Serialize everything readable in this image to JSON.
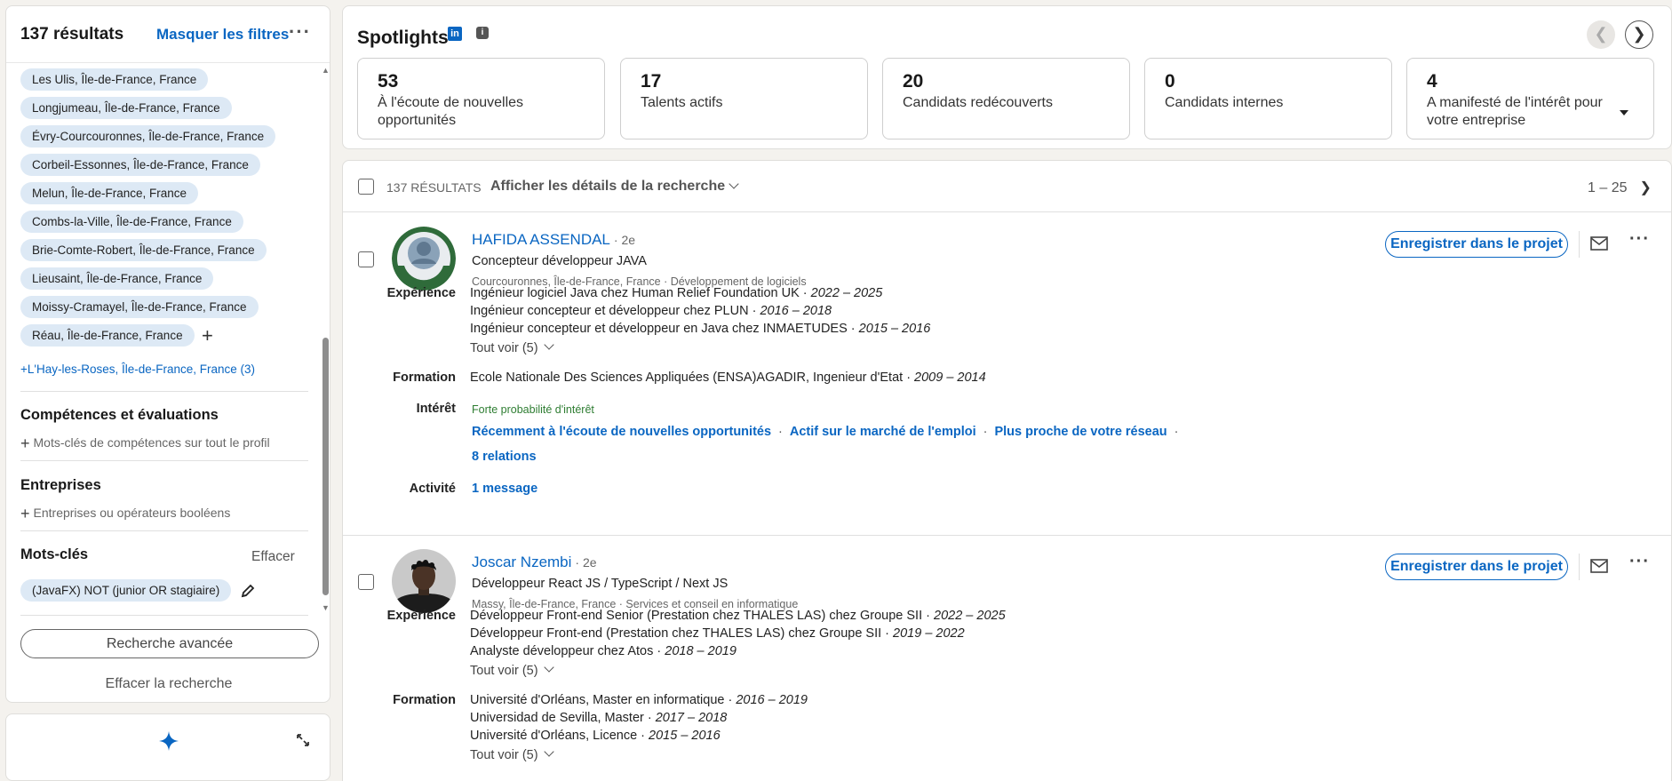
{
  "filters": {
    "result_count": "137 résultats",
    "hide_filters": "Masquer les filtres",
    "locations": [
      "Les Ulis, Île-de-France, France",
      "Longjumeau, Île-de-France, France",
      "Évry-Courcouronnes, Île-de-France, France",
      "Corbeil-Essonnes, Île-de-France, France",
      "Melun, Île-de-France, France",
      "Combs-la-Ville, Île-de-France, France",
      "Brie-Comte-Robert, Île-de-France, France",
      "Lieusaint, Île-de-France, France",
      "Moissy-Cramayel, Île-de-France, France",
      "Réau, Île-de-France, France"
    ],
    "more_locations": "+L'Hay-les-Roses, Île-de-France, France (3)",
    "skills_title": "Compétences et évaluations",
    "skills_add": "Mots-clés de compétences sur tout le profil",
    "companies_title": "Entreprises",
    "companies_add": "Entreprises ou opérateurs booléens",
    "keywords_title": "Mots-clés",
    "keywords_clear": "Effacer",
    "keyword_value": "(JavaFX) NOT (junior OR stagiaire)",
    "advanced_search": "Recherche avancée",
    "clear_search": "Effacer la recherche"
  },
  "spotlights": {
    "title": "Spotlights",
    "li_logo": "in",
    "info_icon": "i",
    "prev": "❮",
    "next": "❯",
    "cards": [
      {
        "num": "53",
        "label": "À l'écoute de nouvelles opportunités"
      },
      {
        "num": "17",
        "label": "Talents actifs"
      },
      {
        "num": "20",
        "label": "Candidats redécouverts"
      },
      {
        "num": "0",
        "label": "Candidats internes"
      },
      {
        "num": "4",
        "label": "A manifesté de l'intérêt pour votre entreprise"
      }
    ]
  },
  "results": {
    "count_label": "137 RÉSULTATS",
    "details_label": "Afficher les détails de la recherche",
    "pager": "1 – 25",
    "pager_next": "❯",
    "save_label": "Enregistrer dans le projet",
    "labels": {
      "experience": "Expérience",
      "education": "Formation",
      "interest": "Intérêt",
      "activity": "Activité"
    },
    "candidates": [
      {
        "name": "HAFIDA ASSENDAL",
        "degree": "· 2e",
        "headline": "Concepteur développeur JAVA",
        "location": "Courcouronnes, Île-de-France, France · Développement de logiciels",
        "experience": [
          {
            "text": "Ingénieur logiciel Java chez Human Relief Foundation UK · ",
            "years": "2022 – 2025"
          },
          {
            "text": "Ingénieur concepteur et développeur chez PLUN · ",
            "years": "2016 – 2018"
          },
          {
            "text": "Ingénieur concepteur et développeur en Java chez INMAETUDES · ",
            "years": "2015 – 2016"
          }
        ],
        "see_all": "Tout voir (5)",
        "education": [
          {
            "text": "Ecole Nationale Des Sciences Appliquées (ENSA)AGADIR, Ingenieur d'Etat · ",
            "years": "2009 – 2014"
          }
        ],
        "interest_level": "Forte probabilité d'intérêt",
        "interest_links": [
          "Récemment à l'écoute de nouvelles opportunités",
          "Actif sur le marché de l'emploi",
          "Plus proche de votre réseau"
        ],
        "relations": "8 relations",
        "activity": "1 message"
      },
      {
        "name": "Joscar Nzembi",
        "degree": "· 2e",
        "headline": "Développeur React JS / TypeScript / Next JS",
        "location": "Massy, Île-de-France, France · Services et conseil en informatique",
        "experience": [
          {
            "text": "Développeur Front-end Senior (Prestation chez THALES LAS) chez Groupe SII · ",
            "years": "2022 – 2025"
          },
          {
            "text": "Développeur Front-end (Prestation chez THALES LAS) chez Groupe SII · ",
            "years": "2019 – 2022"
          },
          {
            "text": "Analyste développeur chez Atos · ",
            "years": "2018 – 2019"
          }
        ],
        "see_all": "Tout voir (5)",
        "education": [
          {
            "text": "Université d'Orléans, Master en informatique · ",
            "years": "2016 – 2019"
          },
          {
            "text": "Universidad de Sevilla, Master · ",
            "years": "2017 – 2018"
          },
          {
            "text": "Université d'Orléans, Licence · ",
            "years": "2015 – 2016"
          }
        ],
        "education_see_all": "Tout voir (5)"
      }
    ]
  },
  "colors": {
    "accent": "#0a66c2",
    "pill": "#dde9f5",
    "interest_green": "#2e7d32"
  }
}
